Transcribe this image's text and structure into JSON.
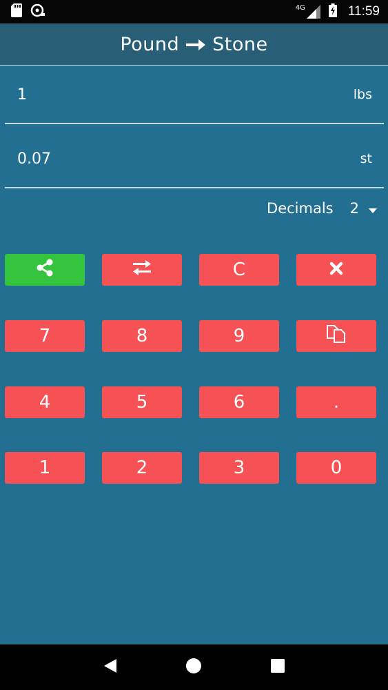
{
  "status_bar": {
    "time": "11:59",
    "network": "4G"
  },
  "header": {
    "from_unit": "Pound",
    "to_unit": "Stone"
  },
  "input": {
    "value": "1",
    "unit": "lbs"
  },
  "output": {
    "value": "0.07",
    "unit": "st"
  },
  "decimals": {
    "label": "Decimals",
    "value": "2"
  },
  "keypad": {
    "clear": "C",
    "k7": "7",
    "k8": "8",
    "k9": "9",
    "k4": "4",
    "k5": "5",
    "k6": "6",
    "dot": ".",
    "k1": "1",
    "k2": "2",
    "k3": "3",
    "k0": "0"
  },
  "colors": {
    "background": "#236f92",
    "appbar": "#285f77",
    "key": "#f65256",
    "share_key": "#34c43e"
  }
}
